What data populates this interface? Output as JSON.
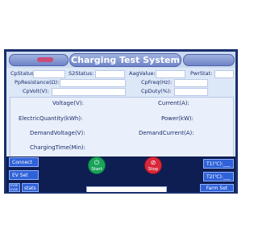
{
  "header": {
    "title": "Charging Test System"
  },
  "status": {
    "cp_status_label": "CpStatus:",
    "s2_status_label": "S2Status:",
    "aag_value_label": "AagValue:",
    "pwr_stat_label": "PwrStat:",
    "pp_resistance_label": "PpResistance(Ω):",
    "cp_freq_label": "CpFreq(Hz):",
    "cp_volt_label": "CpVolt(V):",
    "cp_duty_label": "CpDuty(%):"
  },
  "measurements": {
    "voltage_label": "Voltage(V):",
    "current_label": "Current(A):",
    "electric_quantity_label": "ElectricQuantity(kWh):",
    "power_label": "Power(kW):",
    "demand_voltage_label": "DemandVoltage(V):",
    "demand_current_label": "DemandCurrent(A):",
    "charging_time_label": "ChargingTime(Min):"
  },
  "controls": {
    "connect_label": "Connect",
    "ev_set_label": "EV Set",
    "stats_label": "stats",
    "stats_badge": "EVSE\nEVSE",
    "start_label": "Start",
    "stop_label": "Stop",
    "t1_label": "T1(℃):___",
    "t2_label": "T2(℃):___",
    "farm_set_label": "Farm Set"
  },
  "icons": {
    "start": "power-icon",
    "stop": "no-entry-icon"
  },
  "colors": {
    "frame": "#1a2f6e",
    "screen_bg": "#dce7f7",
    "bottom_bar": "#0e1e52",
    "button_blue": "#2f62d8",
    "start_green": "#1aa35a",
    "stop_red": "#d9283b"
  }
}
